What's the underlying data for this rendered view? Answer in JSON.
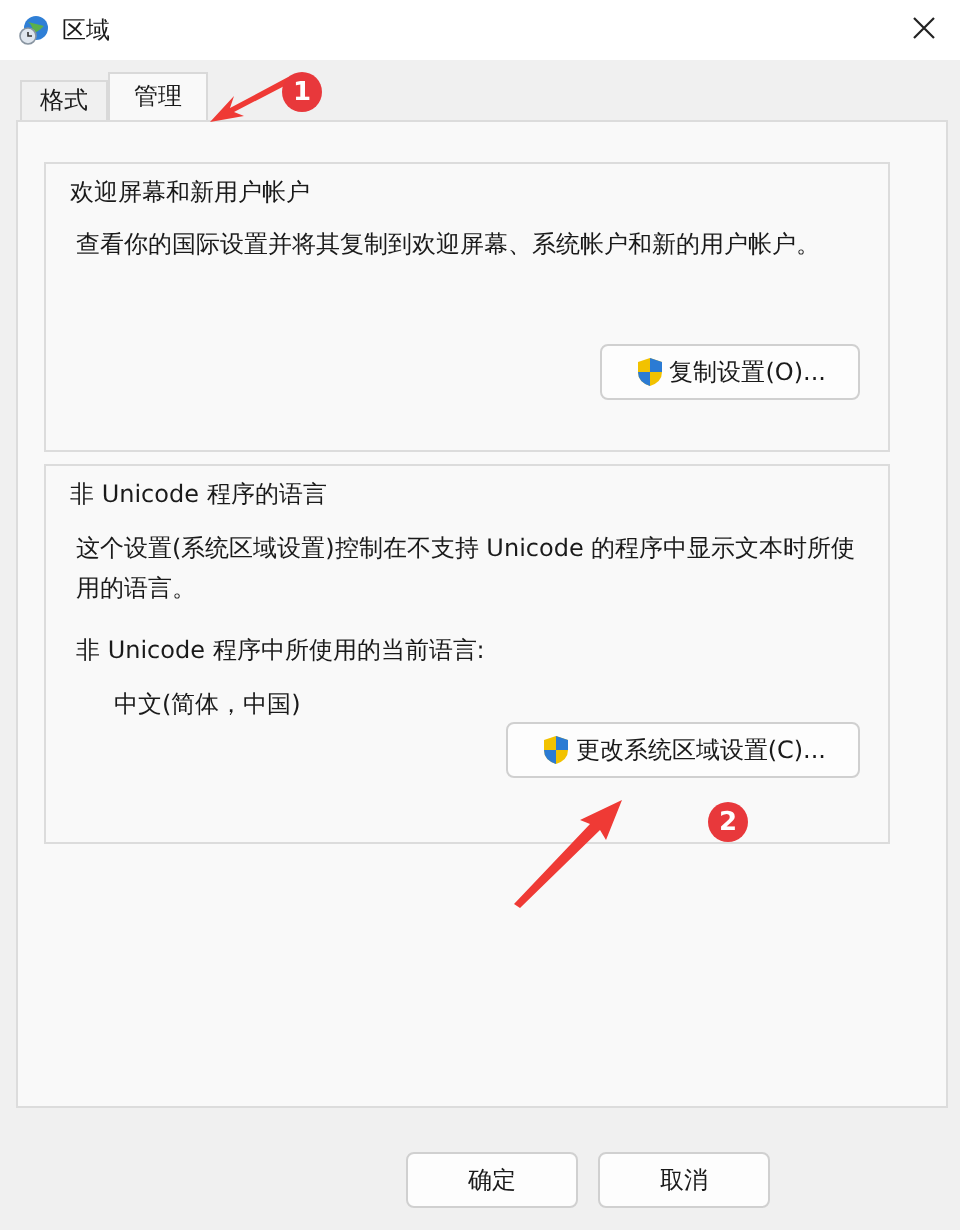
{
  "window": {
    "title": "区域"
  },
  "tabs": [
    {
      "label": "格式",
      "selected": false
    },
    {
      "label": "管理",
      "selected": true
    }
  ],
  "groups": [
    {
      "title": "欢迎屏幕和新用户帐户",
      "description": "查看你的国际设置并将其复制到欢迎屏幕、系统帐户和新的用户帐户。",
      "button": "复制设置(O)..."
    },
    {
      "title": "非 Unicode 程序的语言",
      "description": "这个设置(系统区域设置)控制在不支持 Unicode 的程序中显示文本时所使用的语言。",
      "current_label": "非 Unicode 程序中所使用的当前语言:",
      "current_value": "中文(简体，中国)",
      "button": "更改系统区域设置(C)..."
    }
  ],
  "buttons": [
    "确定",
    "取消"
  ],
  "annotations": [
    {
      "label": "1"
    },
    {
      "label": "2"
    }
  ]
}
